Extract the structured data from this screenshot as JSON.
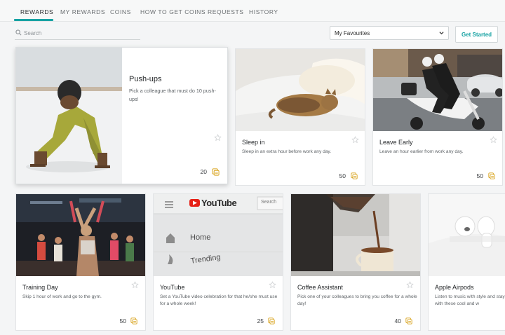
{
  "tabs": [
    {
      "label": "REWARDS",
      "active": true
    },
    {
      "label": "MY REWARDS",
      "active": false
    },
    {
      "label": "COINS",
      "active": false
    },
    {
      "label": "HOW TO GET COINS",
      "active": false
    },
    {
      "label": "REQUESTS",
      "active": false
    },
    {
      "label": "HISTORY",
      "active": false
    }
  ],
  "toolbar": {
    "search_placeholder": "Search",
    "filter_value": "My Favourites",
    "get_started_label": "Get Started"
  },
  "colors": {
    "accent": "#17a2a3",
    "coin": "#d9a520",
    "star": "#c9ccce"
  },
  "featured": {
    "title": "Push-ups",
    "description": "Pick a colleague that must do 10 push-ups!",
    "price": "20"
  },
  "cards": [
    {
      "title": "Sleep in",
      "description": "Sleep in an extra hour before work any day.",
      "price": "50"
    },
    {
      "title": "Leave Early",
      "description": "Leave an hour earlier from work any day.",
      "price": "50"
    },
    {
      "title": "Training Day",
      "description": "Skip 1 hour of work and go to the gym.",
      "price": "50"
    },
    {
      "title": "YouTube",
      "description": "Set a YouTube video celebration for that he/she must use for a whole week!",
      "price": "25",
      "img_words": {
        "brand": "YouTube",
        "search": "Search",
        "home": "Home",
        "trending": "Trending"
      }
    },
    {
      "title": "Coffee Assistant",
      "description": "Pick one of your colleagues to bring you coffee for a whole day!",
      "price": "40"
    },
    {
      "title": "Apple Airpods",
      "description": "Listen to music with style and stay technology with these cool and w"
    }
  ]
}
